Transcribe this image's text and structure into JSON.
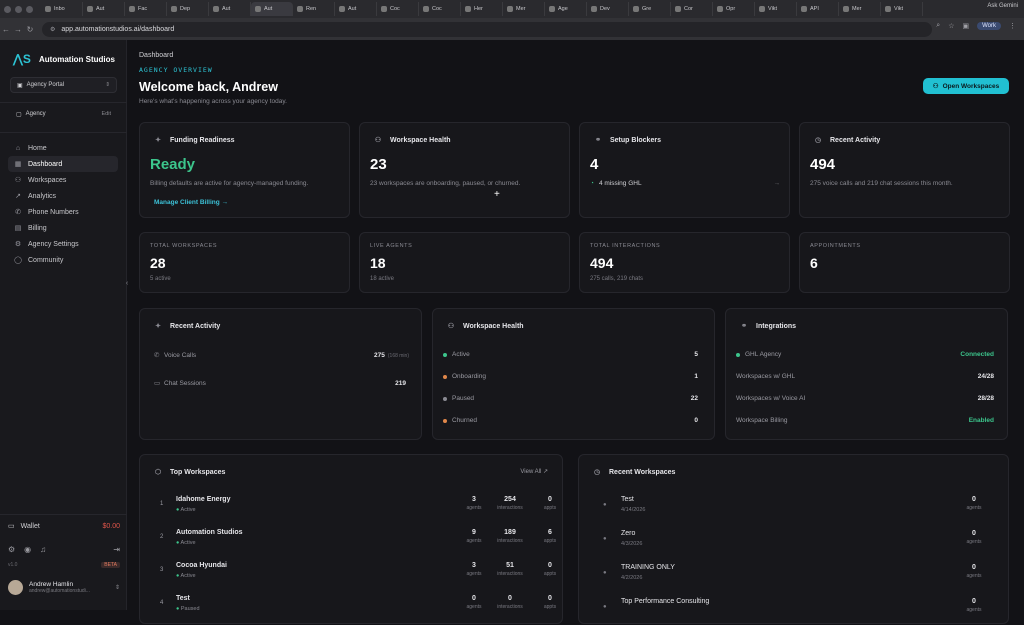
{
  "browser": {
    "tabs": [
      "Inbo",
      "Aut",
      "Fac",
      "Dep",
      "Aut",
      "Aut",
      "Ren",
      "Aut",
      "Coc",
      "Coc",
      "Her",
      "Mer",
      "Age",
      "Dev",
      "Gre",
      "Cor",
      "Opr",
      "Vikt",
      "API",
      "Mer",
      "Vikt"
    ],
    "ask_label": "Ask Gemini",
    "url": "app.automationstudios.ai/dashboard",
    "profile": "Work"
  },
  "sidebar": {
    "brand": "Automation Studios",
    "portal": "Agency Portal",
    "agency": "Agency",
    "edit": "Edit",
    "items": [
      {
        "label": "Home",
        "icon": "home-icon",
        "glyph": "⌂"
      },
      {
        "label": "Dashboard",
        "icon": "dashboard-icon",
        "glyph": "▦"
      },
      {
        "label": "Workspaces",
        "icon": "users-icon",
        "glyph": "⚇"
      },
      {
        "label": "Analytics",
        "icon": "trend-icon",
        "glyph": "↗"
      },
      {
        "label": "Phone Numbers",
        "icon": "phone-icon",
        "glyph": "✆"
      },
      {
        "label": "Billing",
        "icon": "billing-icon",
        "glyph": "▤"
      },
      {
        "label": "Agency Settings",
        "icon": "gear-icon",
        "glyph": "⚙"
      },
      {
        "label": "Community",
        "icon": "chat-icon",
        "glyph": "◯"
      }
    ],
    "wallet_label": "Wallet",
    "wallet_amount": "$0.00",
    "version": "v1.0",
    "beta": "BETA",
    "user_name": "Andrew Hamlin",
    "user_email": "andrew@automationstudi..."
  },
  "header": {
    "breadcrumb": "Dashboard",
    "overline": "AGENCY OVERVIEW",
    "welcome": "Welcome back, Andrew",
    "subtitle": "Here's what's happening across your agency today.",
    "open_button": "Open Workspaces"
  },
  "top_cards": {
    "funding": {
      "title": "Funding Readiness",
      "value": "Ready",
      "desc": "Billing defaults are active for agency-managed funding.",
      "link": "Manage Client Billing"
    },
    "health": {
      "title": "Workspace Health",
      "value": "23",
      "desc": "23 workspaces are onboarding, paused, or churned."
    },
    "blockers": {
      "title": "Setup Blockers",
      "value": "4",
      "item": "4 missing GHL"
    },
    "activity": {
      "title": "Recent Activity",
      "value": "494",
      "desc": "275 voice calls and 219 chat sessions this month."
    }
  },
  "stats": [
    {
      "label": "TOTAL WORKSPACES",
      "value": "28",
      "sub": "5 active"
    },
    {
      "label": "LIVE AGENTS",
      "value": "18",
      "sub": "18 active"
    },
    {
      "label": "TOTAL INTERACTIONS",
      "value": "494",
      "sub": "275 calls, 219 chats"
    },
    {
      "label": "APPOINTMENTS",
      "value": "6",
      "sub": ""
    }
  ],
  "recent_activity": {
    "title": "Recent Activity",
    "rows": [
      {
        "label": "Voice Calls",
        "value": "275",
        "note": "(168 min)"
      },
      {
        "label": "Chat Sessions",
        "value": "219",
        "note": ""
      }
    ]
  },
  "workspace_health": {
    "title": "Workspace Health",
    "rows": [
      {
        "label": "Active",
        "value": "5",
        "color": "#3cc58c"
      },
      {
        "label": "Onboarding",
        "value": "1",
        "color": "#e0874a"
      },
      {
        "label": "Paused",
        "value": "22",
        "color": "#8a8a92"
      },
      {
        "label": "Churned",
        "value": "0",
        "color": "#e0874a"
      }
    ]
  },
  "integrations": {
    "title": "Integrations",
    "rows": [
      {
        "label": "GHL Agency",
        "value": "Connected",
        "ok": true
      },
      {
        "label": "Workspaces w/ GHL",
        "value": "24/28",
        "ok": false
      },
      {
        "label": "Workspaces w/ Voice AI",
        "value": "28/28",
        "ok": false
      },
      {
        "label": "Workspace Billing",
        "value": "Enabled",
        "ok": true
      }
    ]
  },
  "top_workspaces": {
    "title": "Top Workspaces",
    "view_all": "View All",
    "metric_labels": [
      "agents",
      "interactions",
      "appts"
    ],
    "rows": [
      {
        "rank": "1",
        "name": "Idahome Energy",
        "status": "Active",
        "agents": "3",
        "interactions": "254",
        "appts": "0"
      },
      {
        "rank": "2",
        "name": "Automation Studios",
        "status": "Active",
        "agents": "9",
        "interactions": "189",
        "appts": "6"
      },
      {
        "rank": "3",
        "name": "Cocoa Hyundai",
        "status": "Active",
        "agents": "3",
        "interactions": "51",
        "appts": "0"
      },
      {
        "rank": "4",
        "name": "Test",
        "status": "Paused",
        "agents": "0",
        "interactions": "0",
        "appts": "0"
      }
    ]
  },
  "recent_workspaces": {
    "title": "Recent Workspaces",
    "metric_label": "agents",
    "rows": [
      {
        "name": "Test",
        "date": "4/14/2026",
        "agents": "0"
      },
      {
        "name": "Zero",
        "date": "4/3/2026",
        "agents": "0"
      },
      {
        "name": "TRAINING ONLY",
        "date": "4/2/2026",
        "agents": "0"
      },
      {
        "name": "Top Performance Consulting",
        "date": "",
        "agents": "0"
      }
    ]
  }
}
